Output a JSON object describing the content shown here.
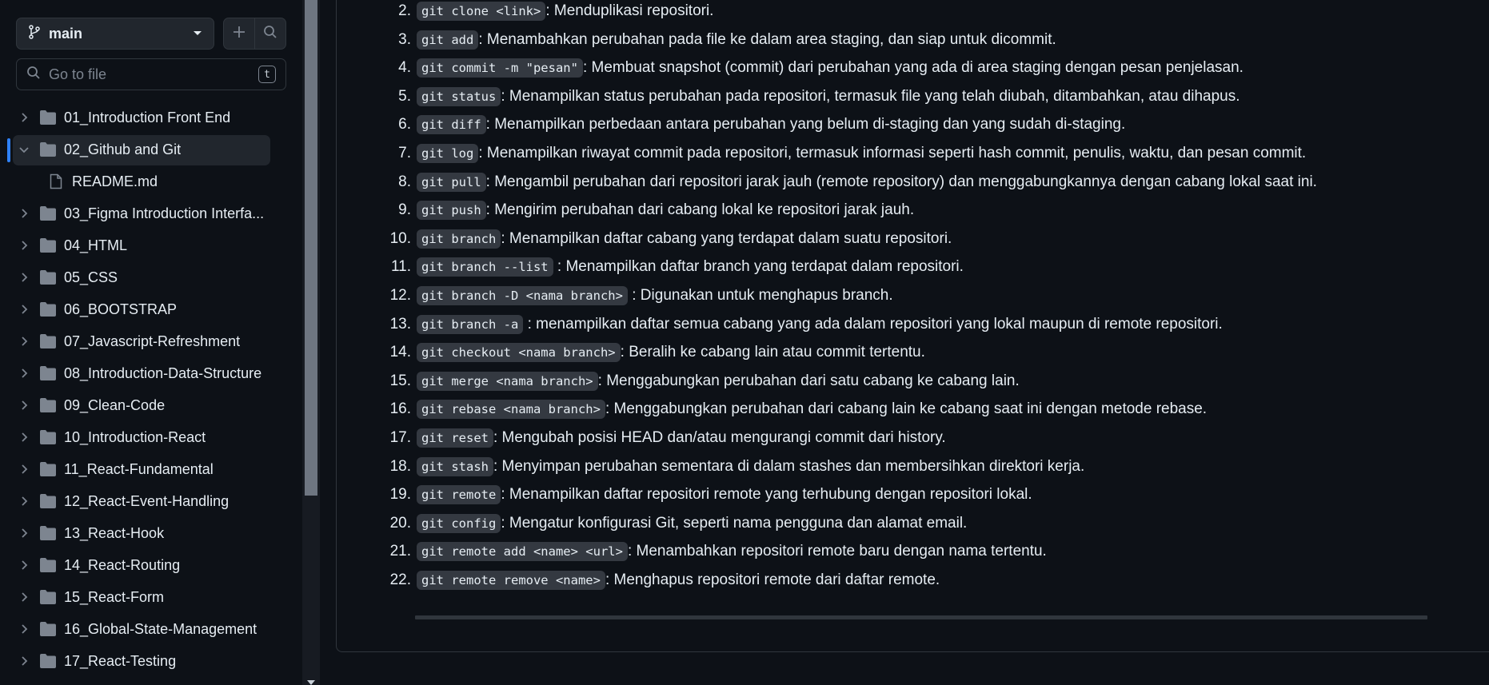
{
  "sidebar": {
    "branch": "main",
    "goto_placeholder": "Go to file",
    "goto_shortcut": "t",
    "tree": [
      {
        "label": "01_Introduction Front End",
        "type": "folder",
        "expanded": false
      },
      {
        "label": "02_Github and Git",
        "type": "folder",
        "expanded": true,
        "active": true
      },
      {
        "label": "README.md",
        "type": "file"
      },
      {
        "label": "03_Figma Introduction Interfa...",
        "type": "folder",
        "expanded": false
      },
      {
        "label": "04_HTML",
        "type": "folder",
        "expanded": false
      },
      {
        "label": "05_CSS",
        "type": "folder",
        "expanded": false
      },
      {
        "label": "06_BOOTSTRAP",
        "type": "folder",
        "expanded": false
      },
      {
        "label": "07_Javascript-Refreshment",
        "type": "folder",
        "expanded": false
      },
      {
        "label": "08_Introduction-Data-Structure",
        "type": "folder",
        "expanded": false
      },
      {
        "label": "09_Clean-Code",
        "type": "folder",
        "expanded": false
      },
      {
        "label": "10_Introduction-React",
        "type": "folder",
        "expanded": false
      },
      {
        "label": "11_React-Fundamental",
        "type": "folder",
        "expanded": false
      },
      {
        "label": "12_React-Event-Handling",
        "type": "folder",
        "expanded": false
      },
      {
        "label": "13_React-Hook",
        "type": "folder",
        "expanded": false
      },
      {
        "label": "14_React-Routing",
        "type": "folder",
        "expanded": false
      },
      {
        "label": "15_React-Form",
        "type": "folder",
        "expanded": false
      },
      {
        "label": "16_Global-State-Management",
        "type": "folder",
        "expanded": false
      },
      {
        "label": "17_React-Testing",
        "type": "folder",
        "expanded": false
      }
    ]
  },
  "content": {
    "commands": [
      {
        "num": "2.",
        "code": "git clone <link>",
        "desc": ": Menduplikasi repositori."
      },
      {
        "num": "3.",
        "code": "git add",
        "desc": ": Menambahkan perubahan pada file ke dalam area staging, dan siap untuk dicommit."
      },
      {
        "num": "4.",
        "code": "git commit -m \"pesan\"",
        "desc": ": Membuat snapshot (commit) dari perubahan yang ada di area staging dengan pesan penjelasan."
      },
      {
        "num": "5.",
        "code": "git status",
        "desc": ": Menampilkan status perubahan pada repositori, termasuk file yang telah diubah, ditambahkan, atau dihapus."
      },
      {
        "num": "6.",
        "code": "git diff",
        "desc": ": Menampilkan perbedaan antara perubahan yang belum di-staging dan yang sudah di-staging."
      },
      {
        "num": "7.",
        "code": "git log",
        "desc": ": Menampilkan riwayat commit pada repositori, termasuk informasi seperti hash commit, penulis, waktu, dan pesan commit."
      },
      {
        "num": "8.",
        "code": "git pull",
        "desc": ": Mengambil perubahan dari repositori jarak jauh (remote repository) dan menggabungkannya dengan cabang lokal saat ini."
      },
      {
        "num": "9.",
        "code": "git push",
        "desc": ": Mengirim perubahan dari cabang lokal ke repositori jarak jauh."
      },
      {
        "num": "10.",
        "code": "git branch",
        "desc": ": Menampilkan daftar cabang yang terdapat dalam suatu repositori."
      },
      {
        "num": "11.",
        "code": "git branch --list",
        "desc": " : Menampilkan daftar branch yang terdapat dalam repositori."
      },
      {
        "num": "12.",
        "code": "git branch -D <nama branch>",
        "desc": " : Digunakan untuk menghapus branch."
      },
      {
        "num": "13.",
        "code": "git branch -a",
        "desc": " : menampilkan daftar semua cabang yang ada dalam repositori yang lokal maupun di remote repositori."
      },
      {
        "num": "14.",
        "code": "git checkout <nama branch>",
        "desc": ": Beralih ke cabang lain atau commit tertentu."
      },
      {
        "num": "15.",
        "code": "git merge <nama branch>",
        "desc": ": Menggabungkan perubahan dari satu cabang ke cabang lain."
      },
      {
        "num": "16.",
        "code": "git rebase <nama branch>",
        "desc": ": Menggabungkan perubahan dari cabang lain ke cabang saat ini dengan metode rebase."
      },
      {
        "num": "17.",
        "code": "git reset",
        "desc": ": Mengubah posisi HEAD dan/atau mengurangi commit dari history."
      },
      {
        "num": "18.",
        "code": "git stash",
        "desc": ": Menyimpan perubahan sementara di dalam stashes dan membersihkan direktori kerja."
      },
      {
        "num": "19.",
        "code": "git remote",
        "desc": ": Menampilkan daftar repositori remote yang terhubung dengan repositori lokal."
      },
      {
        "num": "20.",
        "code": "git config",
        "desc": ": Mengatur konfigurasi Git, seperti nama pengguna dan alamat email."
      },
      {
        "num": "21.",
        "code": "git remote add <name> <url>",
        "desc": ": Menambahkan repositori remote baru dengan nama tertentu."
      },
      {
        "num": "22.",
        "code": "git remote remove <name>",
        "desc": ": Menghapus repositori remote dari daftar remote."
      }
    ]
  },
  "icons": {
    "branch": "git-branch-icon",
    "caret": "triangle-down-icon",
    "add": "plus-icon",
    "search": "search-icon",
    "folder": "folder-icon",
    "file": "file-icon",
    "chevron_right": "chevron-right-icon",
    "chevron_down": "chevron-down-icon"
  }
}
